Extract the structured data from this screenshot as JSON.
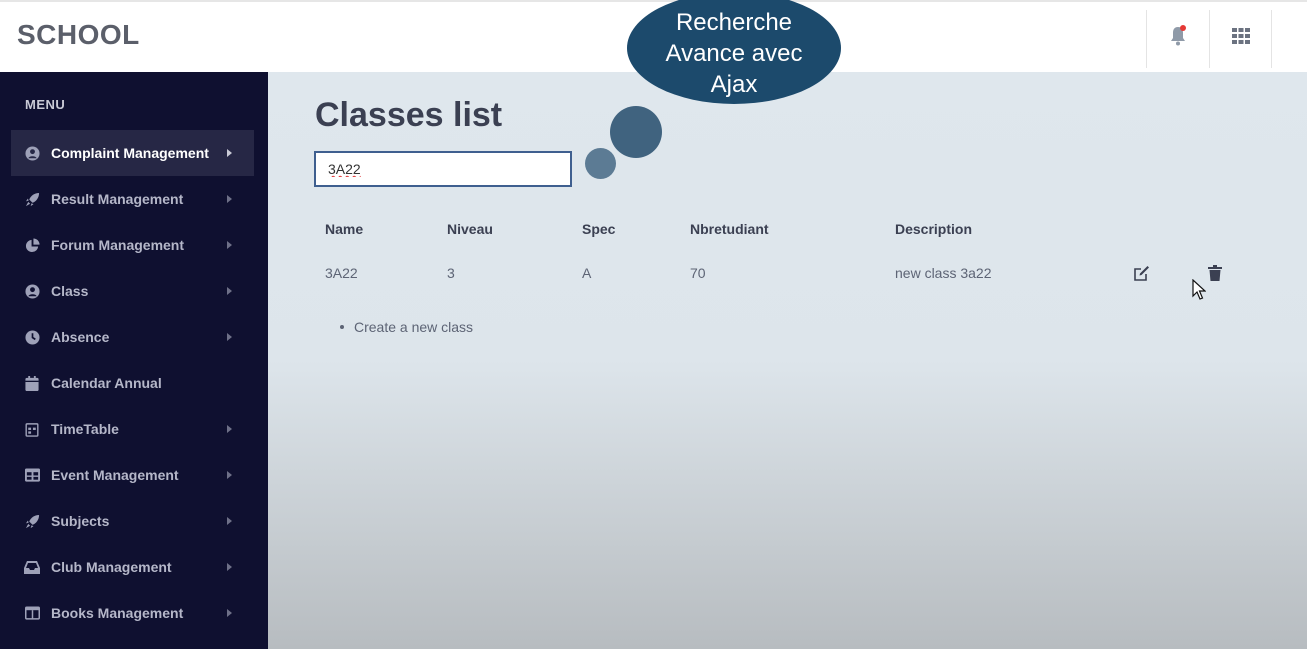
{
  "app": {
    "brand": "SCHOOL"
  },
  "header": {
    "icons": [
      "bell-icon",
      "apps-grid-icon"
    ],
    "notification_color": "#e53935"
  },
  "sidebar": {
    "title": "MENU",
    "items": [
      {
        "label": "Complaint Management",
        "icon": "user-circle-icon",
        "active": true,
        "has_submenu": true
      },
      {
        "label": "Result Management",
        "icon": "rocket-icon",
        "active": false,
        "has_submenu": true
      },
      {
        "label": "Forum Management",
        "icon": "pie-chart-icon",
        "active": false,
        "has_submenu": true
      },
      {
        "label": "Class",
        "icon": "user-circle-icon",
        "active": false,
        "has_submenu": true
      },
      {
        "label": "Absence",
        "icon": "clock-icon",
        "active": false,
        "has_submenu": true
      },
      {
        "label": "Calendar Annual",
        "icon": "calendar-icon",
        "active": false,
        "has_submenu": false
      },
      {
        "label": "TimeTable",
        "icon": "timetable-icon",
        "active": false,
        "has_submenu": true
      },
      {
        "label": "Event Management",
        "icon": "table-icon",
        "active": false,
        "has_submenu": true
      },
      {
        "label": "Subjects",
        "icon": "rocket-icon",
        "active": false,
        "has_submenu": true
      },
      {
        "label": "Club Management",
        "icon": "inbox-icon",
        "active": false,
        "has_submenu": true
      },
      {
        "label": "Books Management",
        "icon": "book-layout-icon",
        "active": false,
        "has_submenu": true
      }
    ]
  },
  "main": {
    "title": "Classes list",
    "search": {
      "value": "3A22"
    },
    "table": {
      "headers": [
        "Name",
        "Niveau",
        "Spec",
        "Nbretudiant",
        "Description"
      ],
      "rows": [
        {
          "name": "3A22",
          "niveau": "3",
          "spec": "A",
          "nbretudiant": "70",
          "description": "new class 3a22",
          "actions": [
            "edit-icon",
            "trash-icon"
          ]
        }
      ]
    },
    "create_link": "Create a new class"
  },
  "overlay": {
    "callout": "Recherche Avance avec Ajax"
  },
  "colors": {
    "sidebar_bg": "#0f1030",
    "sidebar_active": "#262745",
    "callout_bg": "#1c4a6c",
    "search_border": "#3f5f8f"
  }
}
